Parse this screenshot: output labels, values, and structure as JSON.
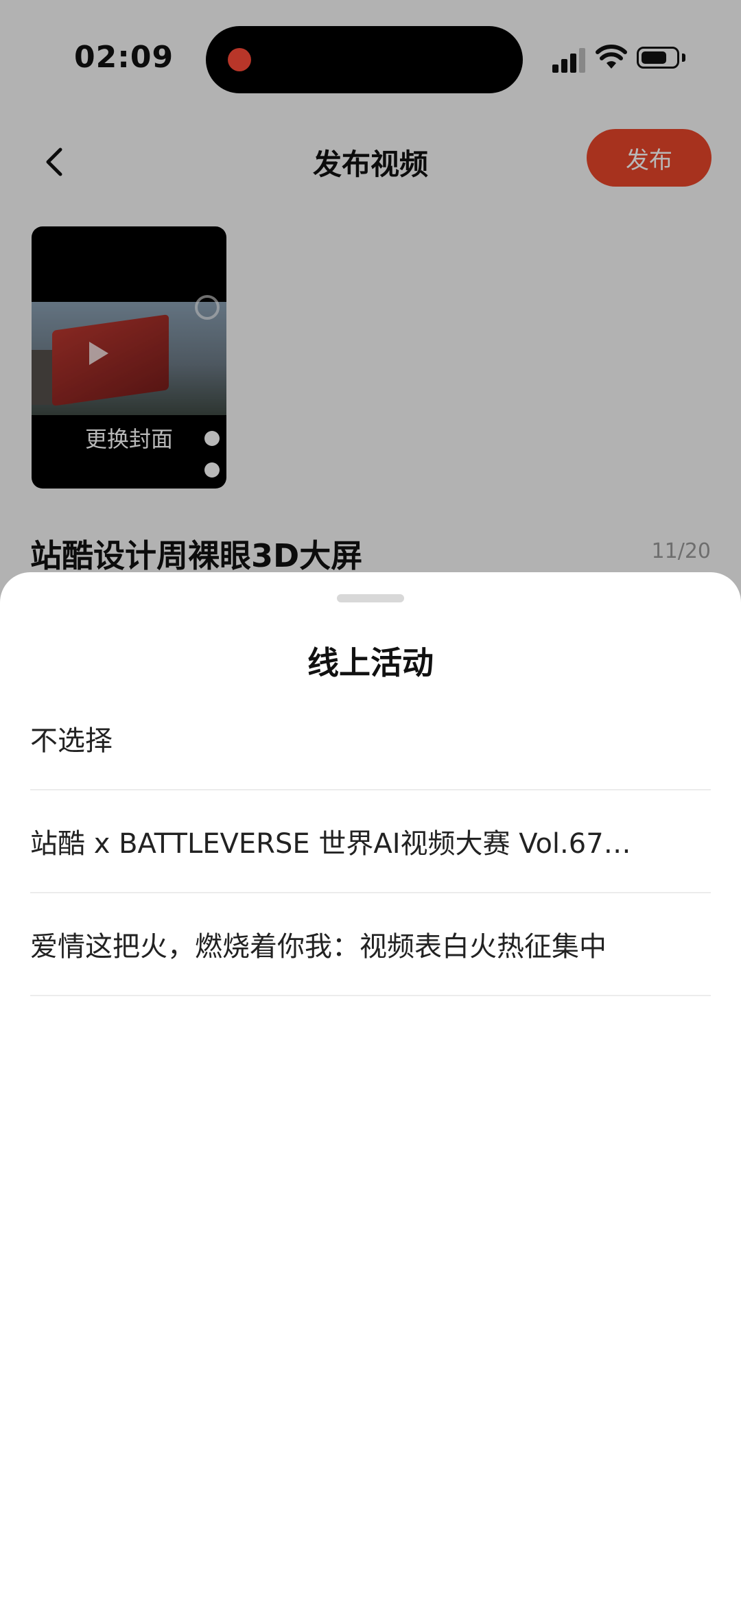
{
  "status_bar": {
    "time": "02:09"
  },
  "header": {
    "title": "发布视频",
    "publish_label": "发布"
  },
  "cover": {
    "change_label": "更换封面"
  },
  "video_title": {
    "text": "站酷设计周裸眼3D大屏",
    "counter": "11/20"
  },
  "sheet": {
    "title": "线上活动",
    "options": [
      {
        "label": "不选择"
      },
      {
        "label": "站酷 x BATTLEVERSE 世界AI视频大赛 Vol.67…"
      },
      {
        "label": "爱情这把火，燃烧着你我：视频表白火热征集中"
      }
    ]
  },
  "colors": {
    "accent": "#e8462a",
    "record_dot": "#ff4b3a"
  }
}
